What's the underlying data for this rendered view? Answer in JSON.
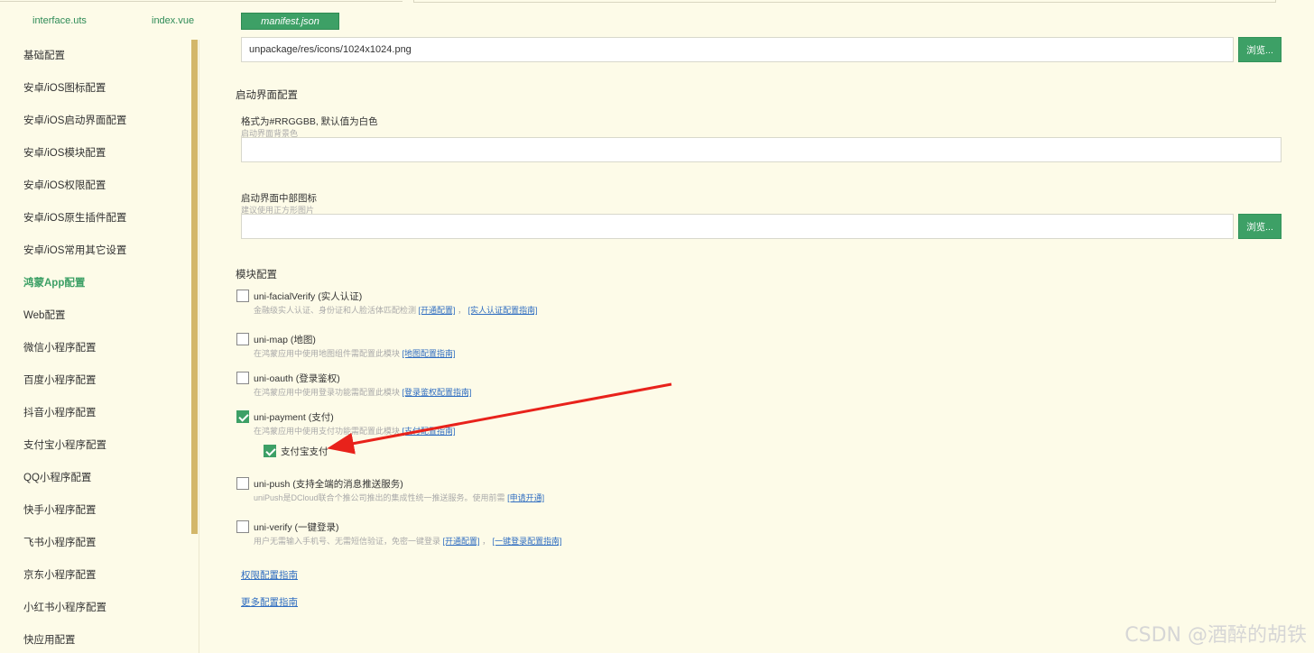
{
  "tabs": [
    {
      "label": "interface.uts",
      "active": false
    },
    {
      "label": "index.vue",
      "active": false
    },
    {
      "label": "manifest.json",
      "active": true
    }
  ],
  "sidebar": {
    "items": [
      {
        "label": "基础配置",
        "active": false
      },
      {
        "label": "安卓/iOS图标配置",
        "active": false
      },
      {
        "label": "安卓/iOS启动界面配置",
        "active": false
      },
      {
        "label": "安卓/iOS模块配置",
        "active": false
      },
      {
        "label": "安卓/iOS权限配置",
        "active": false
      },
      {
        "label": "安卓/iOS原生插件配置",
        "active": false
      },
      {
        "label": "安卓/iOS常用其它设置",
        "active": false
      },
      {
        "label": "鸿蒙App配置",
        "active": true
      },
      {
        "label": "Web配置",
        "active": false
      },
      {
        "label": "微信小程序配置",
        "active": false
      },
      {
        "label": "百度小程序配置",
        "active": false
      },
      {
        "label": "抖音小程序配置",
        "active": false
      },
      {
        "label": "支付宝小程序配置",
        "active": false
      },
      {
        "label": "QQ小程序配置",
        "active": false
      },
      {
        "label": "快手小程序配置",
        "active": false
      },
      {
        "label": "飞书小程序配置",
        "active": false
      },
      {
        "label": "京东小程序配置",
        "active": false
      },
      {
        "label": "小红书小程序配置",
        "active": false
      },
      {
        "label": "快应用配置",
        "active": false
      }
    ]
  },
  "icon_field": {
    "value": "unpackage/res/icons/1024x1024.png",
    "browse_label": "浏览..."
  },
  "splash": {
    "title": "启动界面配置",
    "bg_label": "格式为#RRGGBB, 默认值为白色",
    "bg_hint": "启动界面背景色",
    "bg_value": "",
    "icon_label": "启动界面中部图标",
    "icon_hint": "建议使用正方形图片",
    "icon_value": "",
    "browse_label": "浏览..."
  },
  "modules": {
    "title": "模块配置",
    "items": [
      {
        "label": "uni-facialVerify (实人认证)",
        "checked": false,
        "desc": "金融级实人认证、身份证和人脸活体匹配检测",
        "links": [
          "[开通配置]",
          "[实人认证配置指南]"
        ]
      },
      {
        "label": "uni-map (地图)",
        "checked": false,
        "desc": "在鸿蒙应用中使用地图组件需配置此模块",
        "links": [
          "[地图配置指南]"
        ]
      },
      {
        "label": "uni-oauth (登录鉴权)",
        "checked": false,
        "desc": "在鸿蒙应用中使用登录功能需配置此模块",
        "links": [
          "[登录鉴权配置指南]"
        ]
      },
      {
        "label": "uni-payment (支付)",
        "checked": true,
        "desc": "在鸿蒙应用中使用支付功能需配置此模块",
        "links": [
          "[支付配置指南]"
        ]
      },
      {
        "label": "uni-push (支持全端的消息推送服务)",
        "checked": false,
        "desc": "uniPush是DCloud联合个推公司推出的集成性统一推送服务。使用前需",
        "links": [
          "[申请开通]"
        ]
      },
      {
        "label": "uni-verify (一键登录)",
        "checked": false,
        "desc": "用户无需输入手机号、无需短信验证，免密一键登录",
        "links": [
          "[开通配置]",
          "[一键登录配置指南]"
        ]
      }
    ],
    "sub_option": {
      "label": "支付宝支付",
      "checked": true
    }
  },
  "bottom_links": [
    "权限配置指南",
    "更多配置指南"
  ],
  "watermark": "CSDN @酒醉的胡铁",
  "colors": {
    "accent": "#3da066",
    "background": "#fdfbe8",
    "link": "#2f6dc1",
    "arrow": "#e8221b"
  }
}
